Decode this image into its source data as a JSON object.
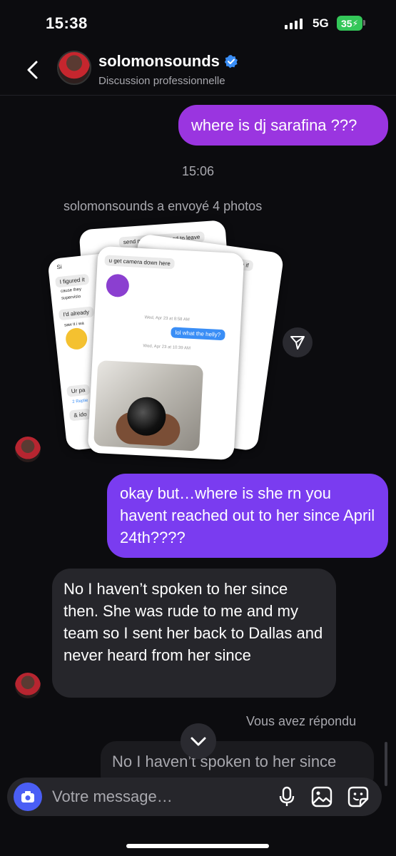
{
  "status_bar": {
    "time": "15:38",
    "network": "5G",
    "battery": "35"
  },
  "header": {
    "username": "solomonsounds",
    "subtitle": "Discussion professionnelle",
    "verified": true
  },
  "messages": {
    "outgoing_1": "where is dj sarafina ???",
    "timestamp": "15:06",
    "photos_label": "solomonsounds a envoyé 4 photos",
    "photo_card_front": {
      "top_bubble": "u get camera down here",
      "date_1": "Wed, Apr 23 at 8:58 AM",
      "blue_bubble": "lol what the helly?",
      "date_2": "Wed, Apr 23 at 10:39 AM"
    },
    "photo_card_back": {
      "line_1": "send me bread i need to leave",
      "line_2": "I'm joking if"
    },
    "photo_card_left": {
      "line_1": "Si",
      "line_2": "I figured it",
      "line_3": "cause they",
      "line_4": "supervisio",
      "line_5": "I'd already",
      "line_6": "saw it i wa",
      "line_7": "Ur pa",
      "line_8": "2 Replie",
      "line_9": "& ido"
    },
    "outgoing_2": "okay but…where is she rn you havent reached out to her since April 24th????",
    "incoming_1": "No I haven’t spoken to her since then. She was rude to me and my team so I sent her back to Dallas and never heard from her since",
    "replied_label": "Vous avez répondu",
    "reply_preview": "No I haven’t spoken to her since"
  },
  "composer": {
    "placeholder": "Votre message…"
  },
  "colors": {
    "background": "#0c0c0f",
    "outgoing_bubble_1": "#9a35e0",
    "outgoing_bubble_2": "#7a3cf0",
    "incoming_bubble": "#26262b",
    "camera_button": "#4a5ef5",
    "verified_badge": "#3a8ef6",
    "battery": "#34c759"
  },
  "icons": [
    "back-icon",
    "verified-icon",
    "share-icon",
    "chevron-down-icon",
    "camera-icon",
    "microphone-icon",
    "gallery-icon",
    "sticker-icon"
  ]
}
